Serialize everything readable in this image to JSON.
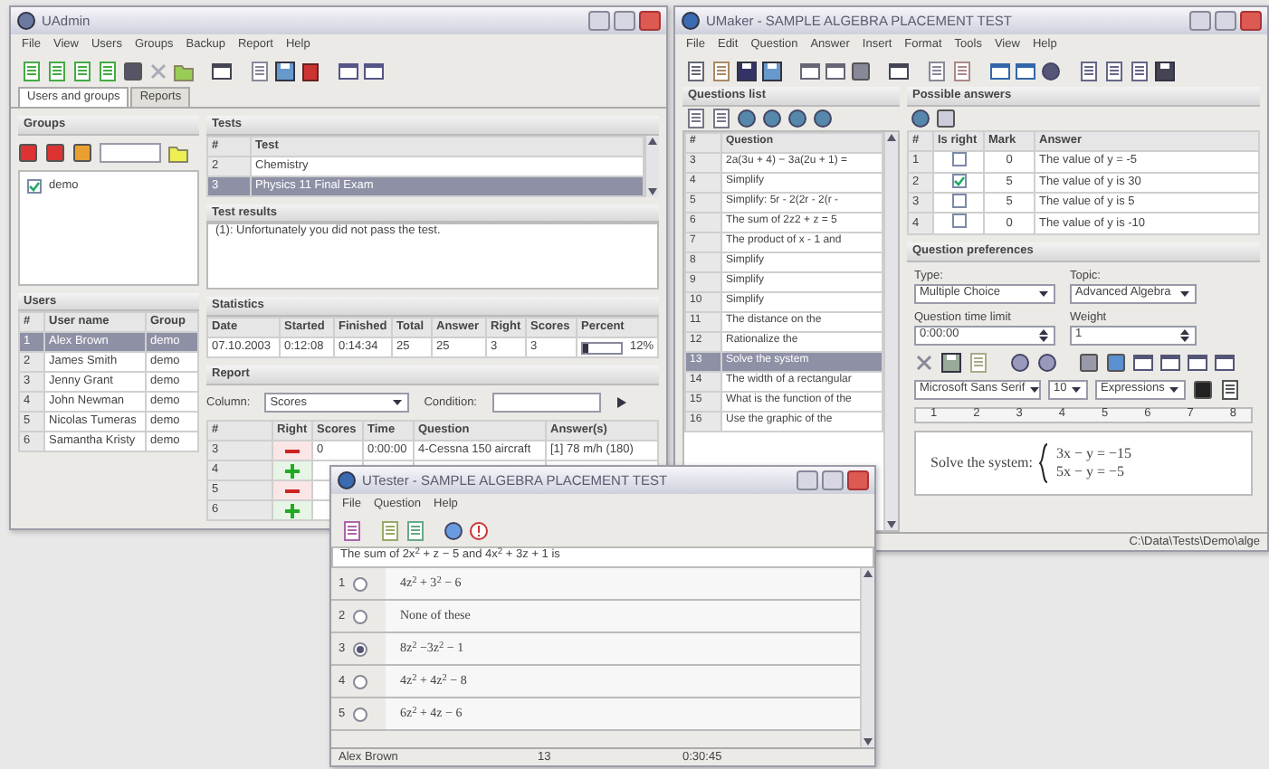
{
  "admin_window": {
    "title": "UAdmin",
    "menu": [
      "File",
      "View",
      "Users",
      "Groups",
      "Backup",
      "Report",
      "Help"
    ],
    "tabs": [
      {
        "label": "Users and groups",
        "selected": true
      },
      {
        "label": "Reports",
        "selected": false
      }
    ],
    "groups": {
      "title": "Groups",
      "items": [
        {
          "label": "demo",
          "checked": true
        }
      ]
    },
    "tests": {
      "title": "Tests",
      "columns": [
        "#",
        "Test"
      ],
      "rows": [
        {
          "cells": [
            "2",
            "Chemistry"
          ],
          "selected": false
        },
        {
          "cells": [
            "3",
            "Physics 11 Final Exam"
          ],
          "selected": true
        }
      ]
    },
    "test_results": {
      "title": "Test results",
      "text": "(1): Unfortunately you did not pass the test."
    },
    "users": {
      "title": "Users",
      "columns": [
        "#",
        "User name",
        "Group"
      ],
      "rows": [
        {
          "cells": [
            "1",
            "Alex Brown",
            "demo"
          ],
          "selected": true
        },
        {
          "cells": [
            "2",
            "James Smith",
            "demo"
          ],
          "selected": false
        },
        {
          "cells": [
            "3",
            "Jenny Grant",
            "demo"
          ],
          "selected": false
        },
        {
          "cells": [
            "4",
            "John Newman",
            "demo"
          ],
          "selected": false
        },
        {
          "cells": [
            "5",
            "Nicolas Tumeras",
            "demo"
          ],
          "selected": false
        },
        {
          "cells": [
            "6",
            "Samantha Kristy",
            "demo"
          ],
          "selected": false
        }
      ]
    },
    "statistics": {
      "title": "Statistics",
      "columns": [
        "Date",
        "Started",
        "Finished",
        "Total",
        "Answer",
        "Right",
        "Scores",
        "Percent"
      ],
      "row": {
        "cells": [
          "07.10.2003",
          "0:12:08",
          "0:14:34",
          "25",
          "25",
          "3",
          "3"
        ],
        "level": 0.12,
        "reading": "12%"
      }
    },
    "report": {
      "title": "Report",
      "column_label": "Column:",
      "column_value": "Scores",
      "condition_label": "Condition:",
      "columns": [
        "#",
        "Right",
        "Scores",
        "Time",
        "Question",
        "Answer(s)"
      ],
      "rows": [
        {
          "number": "3",
          "right": false,
          "cells": [
            "0",
            "0:00:00",
            "4-Cessna 150 aircraft",
            "[1] 78 m/h (180)"
          ]
        },
        {
          "number": "4",
          "right": true
        },
        {
          "number": "5",
          "right": false
        },
        {
          "number": "6",
          "right": true
        }
      ]
    }
  },
  "maker_window": {
    "title": "UMaker - SAMPLE ALGEBRA PLACEMENT TEST",
    "menu": [
      "File",
      "Edit",
      "Question",
      "Answer",
      "Insert",
      "Format",
      "Tools",
      "View",
      "Help"
    ],
    "questions": {
      "title": "Questions list",
      "columns": [
        "#",
        "Question"
      ],
      "rows": [
        {
          "cells": [
            "3",
            "2a(3u + 4) − 3a(2u + 1) ="
          ],
          "selected": false
        },
        {
          "cells": [
            "4",
            "Simplify"
          ],
          "selected": false
        },
        {
          "cells": [
            "5",
            "Simplify: 5r - 2(2r - 2(r -"
          ],
          "selected": false
        },
        {
          "cells": [
            "6",
            "The sum of 2z2 + z = 5"
          ],
          "selected": false
        },
        {
          "cells": [
            "7",
            "The product of x - 1 and"
          ],
          "selected": false
        },
        {
          "cells": [
            "8",
            "Simplify"
          ],
          "selected": false
        },
        {
          "cells": [
            "9",
            "Simplify"
          ],
          "selected": false
        },
        {
          "cells": [
            "10",
            "Simplify"
          ],
          "selected": false
        },
        {
          "cells": [
            "11",
            "The distance on the"
          ],
          "selected": false
        },
        {
          "cells": [
            "12",
            "Rationalize the"
          ],
          "selected": false
        },
        {
          "cells": [
            "13",
            "Solve the system"
          ],
          "selected": true
        },
        {
          "cells": [
            "14",
            "The width of a rectangular"
          ],
          "selected": false
        },
        {
          "cells": [
            "15",
            "What is the function of the"
          ],
          "selected": false
        },
        {
          "cells": [
            "16",
            "Use the graphic of the"
          ],
          "selected": false
        }
      ]
    },
    "answers": {
      "title": "Possible answers",
      "columns": [
        "#",
        "Is right",
        "Mark",
        "Answer"
      ],
      "rows": [
        {
          "number": "1",
          "checked": false,
          "mark": "0",
          "answer": "The value of y = -5"
        },
        {
          "number": "2",
          "checked": true,
          "mark": "5",
          "answer": "The value of y is 30"
        },
        {
          "number": "3",
          "checked": false,
          "mark": "5",
          "answer": "The value of y is 5"
        },
        {
          "number": "4",
          "checked": false,
          "mark": "0",
          "answer": "The value of y is -10"
        }
      ]
    },
    "preferences": {
      "title": "Question preferences",
      "type_label": "Type:",
      "type_value": "Multiple Choice",
      "topic_label": "Topic:",
      "topic_value": "Advanced Algebra",
      "time_label": "Question time limit",
      "time_value": "0:00:00",
      "weight_label": "Weight",
      "weight_value": "1",
      "font_name": "Microsoft Sans Serif",
      "font_size": "10",
      "style": "Expressions",
      "ruler": [
        "1",
        "2",
        "3",
        "4",
        "5",
        "6",
        "7",
        "8"
      ],
      "question_text": "Solve the system:",
      "equations": [
        "3x − y = −15",
        "5x − y = −5"
      ]
    },
    "status": "C:\\Data\\Tests\\Demo\\alge"
  },
  "tester_window": {
    "title": "UTester - SAMPLE ALGEBRA PLACEMENT TEST",
    "menu": [
      "File",
      "Question",
      "Help"
    ],
    "question": "The sum of 2x$^{2}$ + z − 5 and 4x$^{2}$ + 3z + 1 is",
    "options": [
      {
        "number": "1",
        "text": "4z$^{2}$ + 3$^{2}$ − 6",
        "selected": false
      },
      {
        "number": "2",
        "text": "None of these",
        "selected": false
      },
      {
        "number": "3",
        "text": "8z$^{2}$ −3z$^{2}$ − 1",
        "selected": true
      },
      {
        "number": "4",
        "text": "4z$^{2}$ + 4z$^{2}$ − 8",
        "selected": false
      },
      {
        "number": "5",
        "text": "6z$^{2}$ + 4z − 6",
        "selected": false
      }
    ],
    "status": [
      "Alex Brown",
      "13",
      "0:30:45"
    ]
  }
}
